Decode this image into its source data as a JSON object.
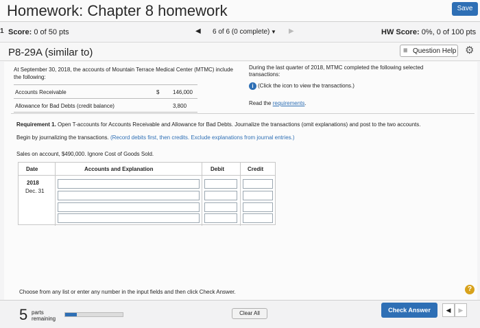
{
  "header": {
    "title": "Homework: Chapter 8 homework",
    "save_label": "Save"
  },
  "score_bar": {
    "mark": "1",
    "score_label": "Score:",
    "score_value": "0 of 50 pts",
    "nav_prev": "◀",
    "progress": "6 of 6 (0 complete)",
    "dropdown_caret": "▼",
    "nav_next": "▶",
    "hw_score_label": "HW Score:",
    "hw_score_value": "0%, 0 of 100 pts"
  },
  "problem_bar": {
    "problem_id": "P8-29A (similar to)",
    "question_help_icon": "list-icon",
    "question_help_label": "Question Help",
    "gear_icon": "gear-icon"
  },
  "problem": {
    "intro": "At September 30, 2018, the accounts of Mountain Terrace Medical Center (MTMC) include the following:",
    "accounts": [
      {
        "name": "Accounts Receivable",
        "symbol": "$",
        "value": "146,000"
      },
      {
        "name": "Allowance for Bad Debts (credit balance)",
        "symbol": "",
        "value": "3,800"
      }
    ],
    "right_info": "During the last quarter of 2018, MTMC completed the following selected transactions:",
    "info_icon": "info-icon",
    "click_text": "(Click the icon to view the transactions.)",
    "read_prefix": "Read the ",
    "requirements_link": "requirements",
    "read_suffix": "."
  },
  "requirement": {
    "label": "Requirement 1.",
    "text": " Open T-accounts for Accounts Receivable and Allowance for Bad Debts. Journalize the transactions (omit explanations) and post to the two accounts.",
    "line2": "Begin by journalizing the transactions. ",
    "hint": "(Record debits first, then credits. Exclude explanations from journal entries.)",
    "sales": "Sales on account, $490,000. Ignore Cost of Goods Sold."
  },
  "journal": {
    "headers": [
      "Date",
      "Accounts and Explanation",
      "Debit",
      "Credit"
    ],
    "year": "2018",
    "day": "Dec. 31"
  },
  "bottom_note": "Choose from any list or enter any number in the input fields and then click Check Answer.",
  "help_circle": "?",
  "footer": {
    "parts_number": "5",
    "parts_label_1": "parts",
    "parts_label_2": "remaining",
    "parts_progress": 0.2,
    "clear_label": "Clear All",
    "check_label": "Check Answer",
    "prev_arrow": "◀",
    "next_arrow": "▶"
  },
  "colors": {
    "accent": "#2e6fb5",
    "help": "#d8a21b"
  }
}
